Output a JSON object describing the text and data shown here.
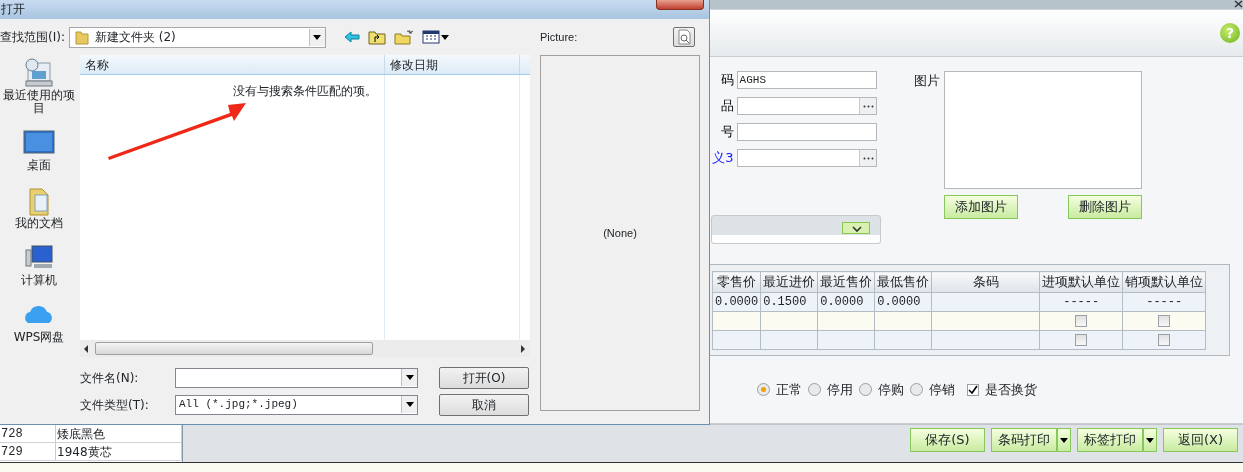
{
  "dialog": {
    "title": "打开",
    "look_in_label": "查找范围(I):",
    "look_in_value": "新建文件夹 (2)",
    "places": [
      {
        "label": "最近使用的项目",
        "kind": "recent"
      },
      {
        "label": "桌面",
        "kind": "desktop"
      },
      {
        "label": "我的文档",
        "kind": "documents"
      },
      {
        "label": "计算机",
        "kind": "computer"
      },
      {
        "label": "WPS网盘",
        "kind": "cloud"
      }
    ],
    "file_list": {
      "columns": [
        "名称",
        "修改日期"
      ],
      "empty_message": "没有与搜索条件匹配的项。"
    },
    "file_name_label": "文件名(N):",
    "file_type_label": "文件类型(T):",
    "file_type_value": "All (*.jpg;*.jpeg)",
    "buttons": [
      "打开(O)",
      "取消"
    ],
    "preview": {
      "label": "Picture:",
      "empty_text": "(None)"
    }
  },
  "form": {
    "help": "?",
    "fields": [
      {
        "label": "码",
        "value": "AGHS",
        "kind": "text",
        "linked": false
      },
      {
        "label": "品",
        "kind": "lookup",
        "linked": false
      },
      {
        "label": "号",
        "kind": "text",
        "linked": false
      },
      {
        "label": "义3",
        "kind": "lookup",
        "linked": true
      }
    ],
    "image_label": "图片",
    "image_buttons": [
      "添加图片",
      "删除图片"
    ]
  },
  "grid": {
    "columns": [
      "零售价",
      "最近进价",
      "最近售价",
      "最低售价",
      "条码",
      "进项默认单位",
      "销项默认单位"
    ],
    "rows": [
      {
        "kind": "text",
        "cells": [
          "0.0000",
          "0.1500",
          "0.0000",
          "0.0000"
        ],
        "in_default": "-----",
        "out_default": "-----"
      },
      {
        "kind": "check",
        "in_default_checked": false,
        "out_default_checked": false
      },
      {
        "kind": "check",
        "in_default_checked": false,
        "out_default_checked": false
      }
    ]
  },
  "status_options": [
    {
      "label": "正常",
      "selected": true
    },
    {
      "label": "停用",
      "selected": false
    },
    {
      "label": "停购",
      "selected": false
    },
    {
      "label": "停销",
      "selected": false
    }
  ],
  "exchange": {
    "label": "是否换货",
    "checked": true
  },
  "actions": [
    {
      "label": "保存(S)",
      "split": false
    },
    {
      "label": "条码打印",
      "split": true
    },
    {
      "label": "标签打印",
      "split": true
    },
    {
      "label": "返回(X)",
      "split": false
    }
  ],
  "background_list": {
    "rows": [
      [
        "728",
        "矮底黑色"
      ],
      [
        "729",
        "1948黄芯"
      ]
    ]
  }
}
